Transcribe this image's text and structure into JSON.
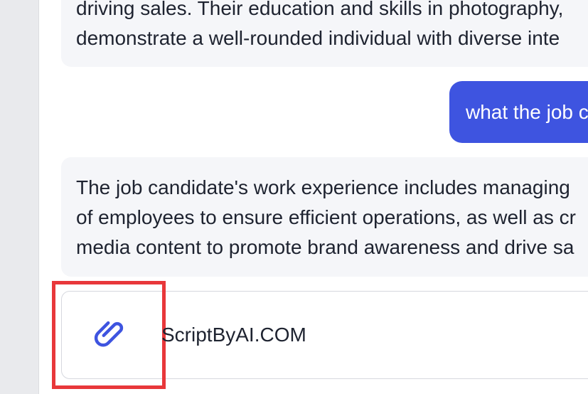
{
  "conversation": {
    "assistant_message_1": {
      "lines": [
        "driving sales. Their education and skills in photography,",
        "demonstrate a well-rounded individual with diverse inte"
      ]
    },
    "user_message": {
      "text": "what the job c"
    },
    "assistant_message_2": {
      "lines": [
        "The job candidate's work experience includes managing",
        "of employees to ensure efficient operations, as well as cr",
        "media content to promote brand awareness and drive sa"
      ]
    }
  },
  "composer": {
    "attach_icon": "paperclip-icon",
    "text": "ScriptByAI.COM"
  },
  "colors": {
    "user_bubble": "#3e54e0",
    "assistant_bubble": "#f5f6f9",
    "paperclip": "#3e54e0",
    "highlight": "#e8373a"
  }
}
